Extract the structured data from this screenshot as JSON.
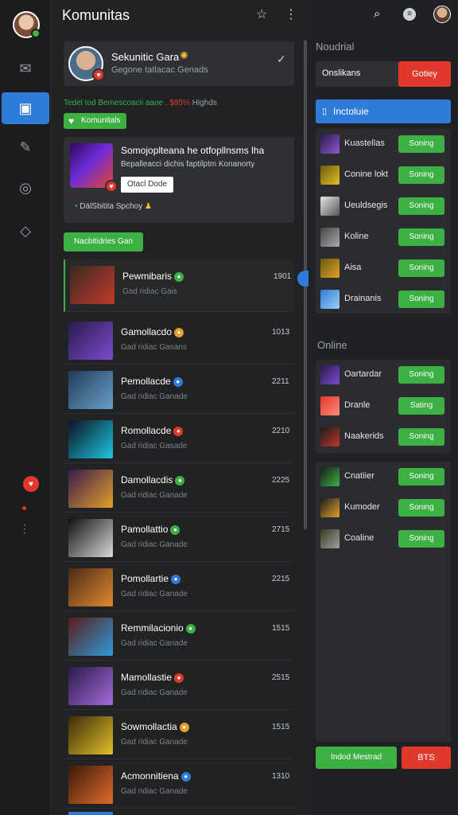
{
  "app": {
    "title": "Komunitas"
  },
  "profile": {
    "name": "Sekunitic Gara",
    "sub": "Gegone tatlacac Genads"
  },
  "status_line": {
    "green": "Tedel tod Bemescoacii aaoe",
    "red": ". $85%",
    "gray": "Highds"
  },
  "green_pill": "Komunitals",
  "feature": {
    "title": "Somojoplteana he otfopllnsms lha",
    "desc": "Bepalleacci dichis faptilptm Konanorty",
    "button": "Otacl Dode",
    "footer": "DälSbitita Spchoy"
  },
  "section_button": "Nacbitidries Gan",
  "list": [
    {
      "title": "Pewmibaris",
      "sub": "Gad ridiac Gais",
      "num": "1901",
      "icon_color": "#3cb043"
    },
    {
      "title": "Gamollacdo",
      "sub": "Gad ridiac Gasans",
      "num": "1013",
      "icon_color": "#e2a02b"
    },
    {
      "title": "Pemollacde",
      "sub": "Gad ridiac Ganade",
      "num": "2211",
      "icon_color": "#2f7bd8"
    },
    {
      "title": "Romollacde",
      "sub": "Gad ridiac Gasade",
      "num": "2210",
      "icon_color": "#e0392b"
    },
    {
      "title": "Damollacdis",
      "sub": "Gad ridiac Ganade",
      "num": "2225",
      "icon_color": "#3cb043"
    },
    {
      "title": "Pamollattio",
      "sub": "Gad ridiac Ganade",
      "num": "2715",
      "icon_color": "#3cb043"
    },
    {
      "title": "Pomollartie",
      "sub": "Gad ridiac Ganade",
      "num": "2215",
      "icon_color": "#2f7bd8"
    },
    {
      "title": "Remmilacionio",
      "sub": "Gad ridiac Ganade",
      "num": "1515",
      "icon_color": "#3cb043"
    },
    {
      "title": "Mamollastie",
      "sub": "Gad ridiac Ganade",
      "num": "2515",
      "icon_color": "#e0392b"
    },
    {
      "title": "Sowmollactia",
      "sub": "Gad ridiac Ganade",
      "num": "1515",
      "icon_color": "#e2a02b"
    },
    {
      "title": "Acmonnitiena",
      "sub": "Gad ridiac Ganade",
      "num": "1310",
      "icon_color": "#2f7bd8"
    }
  ],
  "right": {
    "heading1": "Noudrial",
    "seg_left": "Onslikans",
    "seg_right": "Gotiey",
    "tab": "Inctoluie",
    "group1": [
      {
        "name": "Kuastellas",
        "btn": "Soning"
      },
      {
        "name": "Conine lokt",
        "btn": "Soning"
      },
      {
        "name": "Ueuldsegis",
        "btn": "Soning"
      },
      {
        "name": "Koline",
        "btn": "Soning"
      },
      {
        "name": "Aisa",
        "btn": "Soning"
      },
      {
        "name": "Drainanis",
        "btn": "Soning"
      }
    ],
    "heading2": "Online",
    "group2": [
      {
        "name": "Oartardar",
        "btn": "Soning"
      },
      {
        "name": "Dranle",
        "btn": "Sating"
      },
      {
        "name": "Naakerids",
        "btn": "Soning"
      }
    ],
    "group3": [
      {
        "name": "Cnatiier",
        "btn": "Soning"
      },
      {
        "name": "Kumoder",
        "btn": "Soning"
      },
      {
        "name": "Coaline",
        "btn": "Soning"
      }
    ],
    "btn_green": "Indod Mestrad",
    "btn_red": "BTS"
  },
  "colors": {
    "green": "#3cb043",
    "red": "#e0392b",
    "blue": "#2f7bd8"
  }
}
